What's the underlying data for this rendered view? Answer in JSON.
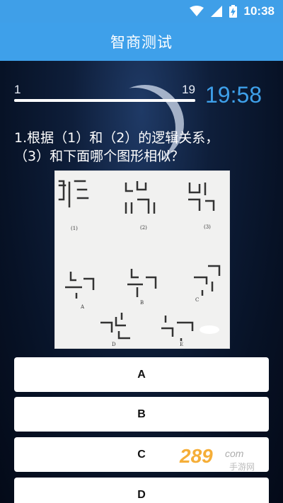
{
  "status_bar": {
    "time": "10:38",
    "icons": [
      "wifi-icon",
      "cell-signal-icon",
      "battery-charging-icon"
    ]
  },
  "app_bar": {
    "title": "智商测试"
  },
  "progress": {
    "min_label": "1",
    "max_label": "19",
    "current_fraction": 1.0
  },
  "timer": {
    "value": "19:58"
  },
  "question": {
    "line1": "1.根据（1）和（2）的逻辑关系，",
    "line2": "（3）和下面哪个图形相似？"
  },
  "figure": {
    "top_labels": [
      "(1)",
      "(2)",
      "(3)"
    ],
    "option_labels": [
      "A",
      "B",
      "C",
      "D",
      "E"
    ]
  },
  "options": [
    {
      "label": "A"
    },
    {
      "label": "B"
    },
    {
      "label": "C"
    },
    {
      "label": "D"
    }
  ],
  "watermark": {
    "digits": "289",
    "suffix": "com",
    "text": "手游网"
  }
}
